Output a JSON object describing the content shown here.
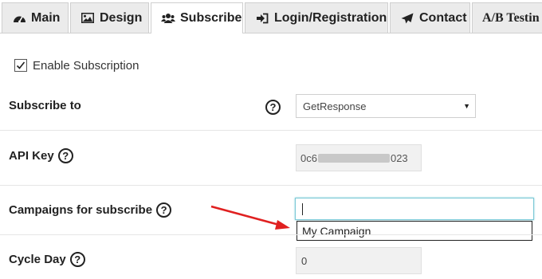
{
  "tabs": [
    {
      "label": "Main",
      "icon": "dashboard-icon"
    },
    {
      "label": "Design",
      "icon": "image-icon"
    },
    {
      "label": "Subscribe",
      "icon": "users-icon",
      "active": true
    },
    {
      "label": "Login/Registration",
      "icon": "sign-in-icon"
    },
    {
      "label": "Contact",
      "icon": "paper-plane-icon"
    },
    {
      "label": "A/B Testin",
      "icon": ""
    }
  ],
  "enable_subscription": {
    "label": "Enable Subscription",
    "checked": true
  },
  "subscribe_to": {
    "label": "Subscribe to",
    "help": "?",
    "selected": "GetResponse"
  },
  "api_key": {
    "label": "API Key",
    "help": "?",
    "prefix": "0c6",
    "suffix": "023"
  },
  "campaigns": {
    "label": "Campaigns for subscribe",
    "help": "?",
    "value": "",
    "suggestion": "My Campaign"
  },
  "cycle_day": {
    "label": "Cycle Day",
    "help": "?",
    "value": "0"
  },
  "colors": {
    "arrow": "#e02020",
    "input_focus": "#7cc9d6",
    "tab_bg": "#ebebeb"
  }
}
